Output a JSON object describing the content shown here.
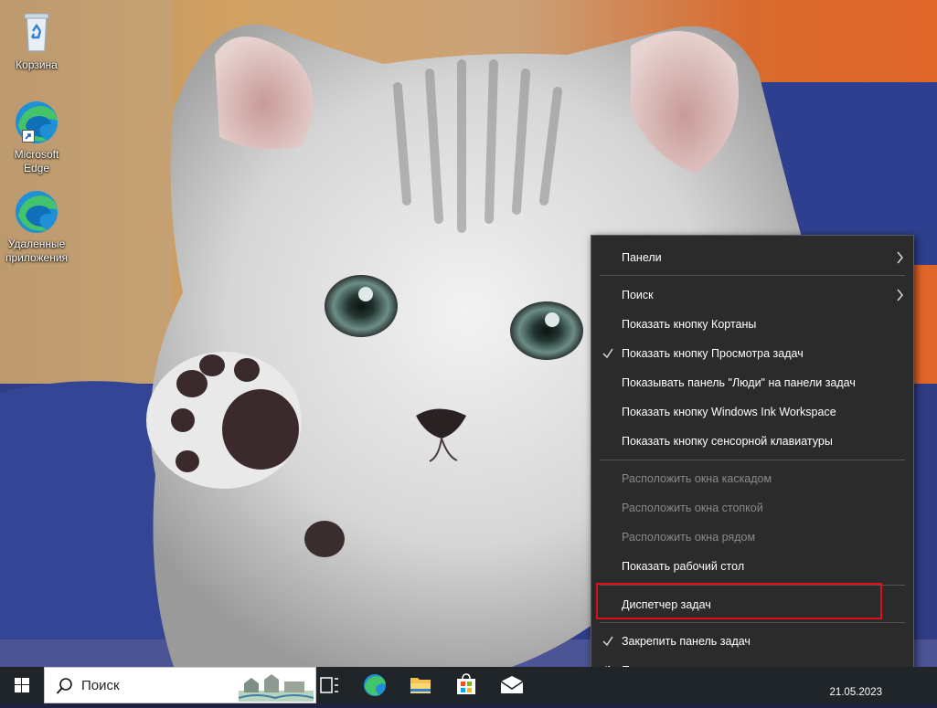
{
  "desktop": {
    "icons": [
      {
        "label": "Корзина",
        "icon": "recycle-bin-icon"
      },
      {
        "label": "Microsoft Edge",
        "icon": "edge-icon"
      },
      {
        "label": "Удаленные приложения",
        "icon": "edge-icon"
      }
    ]
  },
  "context_menu": {
    "items": [
      {
        "label": "Панели",
        "has_submenu": true,
        "checked": false,
        "enabled": true
      },
      {
        "label": "Поиск",
        "has_submenu": true,
        "checked": false,
        "enabled": true
      },
      {
        "label": "Показать кнопку Кортаны",
        "checked": false,
        "enabled": true
      },
      {
        "label": "Показать кнопку Просмотра задач",
        "checked": true,
        "enabled": true
      },
      {
        "label": "Показывать панель \"Люди\" на панели задач",
        "checked": false,
        "enabled": true
      },
      {
        "label": "Показать кнопку Windows Ink Workspace",
        "checked": false,
        "enabled": true
      },
      {
        "label": "Показать кнопку сенсорной клавиатуры",
        "checked": false,
        "enabled": true
      },
      {
        "label": "Расположить окна каскадом",
        "checked": false,
        "enabled": false
      },
      {
        "label": "Расположить окна стопкой",
        "checked": false,
        "enabled": false
      },
      {
        "label": "Расположить окна рядом",
        "checked": false,
        "enabled": false
      },
      {
        "label": "Показать рабочий стол",
        "checked": false,
        "enabled": true
      },
      {
        "label": "Диспетчер задач",
        "checked": false,
        "enabled": true,
        "highlighted": true
      },
      {
        "label": "Закрепить панель задач",
        "checked": true,
        "enabled": true
      },
      {
        "label": "Параметры панели задач",
        "icon": "gear-icon",
        "enabled": true
      }
    ],
    "highlight_color": "#e0101a"
  },
  "taskbar": {
    "search_placeholder": "Поиск",
    "apps": [
      "search-scenery-icon",
      "task-view-icon",
      "edge-icon",
      "file-explorer-icon",
      "store-icon",
      "mail-icon"
    ],
    "clock_date": "21.05.2023"
  }
}
